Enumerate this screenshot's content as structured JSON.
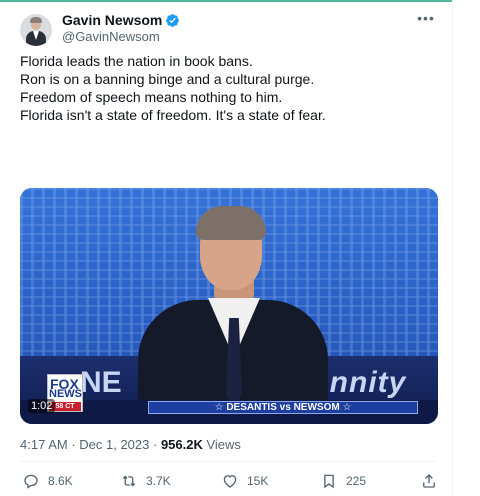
{
  "author": {
    "name": "Gavin Newsom",
    "handle": "@GavinNewsom",
    "verified": true
  },
  "tweet": {
    "paragraphs": [
      "Florida leads the nation in book bans.",
      "Ron is on a banning binge and a cultural purge.",
      "Freedom of speech means nothing to him.",
      "Florida isn't a state of freedom. It's a state of fear."
    ],
    "more_icon": "more-horizontal-icon"
  },
  "media": {
    "duration": "1:02",
    "network_logo_top": "FOX",
    "network_logo_bottom": "NEWS",
    "network_logo_sub": "58 CT",
    "backdrop_left": "NE",
    "backdrop_right": "annity",
    "ticker": "☆ DESANTIS vs NEWSOM ☆"
  },
  "meta": {
    "time": "4:17 AM",
    "separator": " · ",
    "date": "Dec 1, 2023",
    "views_count": "956.2K",
    "views_label": " Views"
  },
  "actions": {
    "replies": "8.6K",
    "reposts": "3.7K",
    "likes": "15K",
    "bookmarks": "225"
  },
  "colors": {
    "accent_top": "#4cb59a",
    "verified": "#1d9bf0",
    "text_primary": "#0f1419",
    "text_secondary": "#536471"
  }
}
